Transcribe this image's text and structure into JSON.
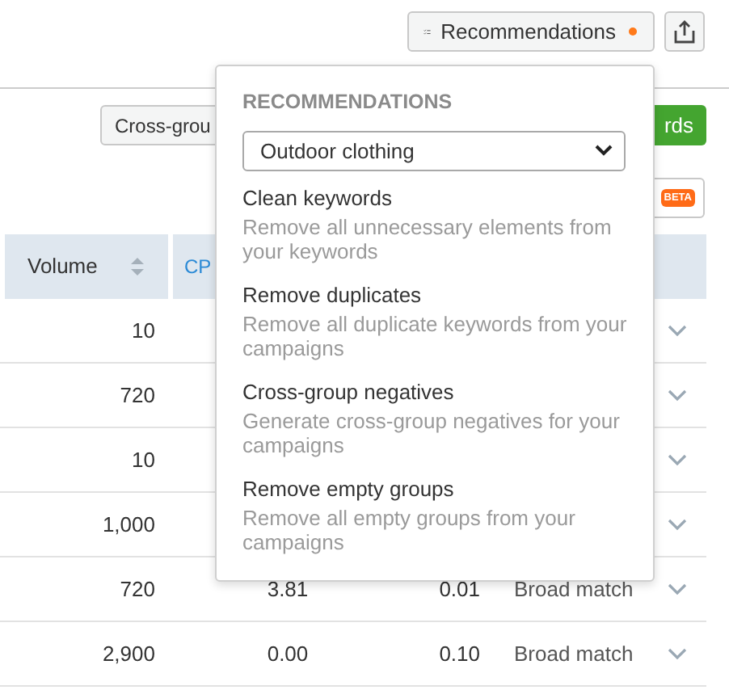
{
  "toolbar": {
    "recommendations_button": {
      "label": "Recommendations",
      "has_notification": true
    }
  },
  "actions": {
    "cross_group_button": {
      "label": "Cross-grou"
    },
    "green_button": {
      "label": "rds"
    },
    "beta_badge": "BETA"
  },
  "table": {
    "columns": [
      {
        "label": "Volume",
        "sortable": true,
        "kind": "plain"
      },
      {
        "label": "CP",
        "kind": "link"
      }
    ],
    "rows": [
      {
        "volume": "10"
      },
      {
        "volume": "720"
      },
      {
        "volume": "10"
      },
      {
        "volume": "1,000"
      },
      {
        "volume": "720",
        "cpc": "3.81",
        "column_3": "0.01",
        "match": "Broad match"
      },
      {
        "volume": "2,900",
        "cpc": "0.00",
        "column_3": "0.10",
        "match": "Broad match"
      }
    ]
  },
  "dropdown": {
    "title": "RECOMMENDATIONS",
    "select": {
      "value": "Outdoor clothing"
    },
    "items": [
      {
        "title": "Clean keywords",
        "description": "Remove all unnecessary elements from your keywords"
      },
      {
        "title": "Remove duplicates",
        "description": "Remove all duplicate keywords from your campaigns"
      },
      {
        "title": "Cross-group negatives",
        "description": "Generate cross-group negatives for your campaigns"
      },
      {
        "title": "Remove empty groups",
        "description": "Remove all empty groups from your campaigns"
      }
    ]
  }
}
